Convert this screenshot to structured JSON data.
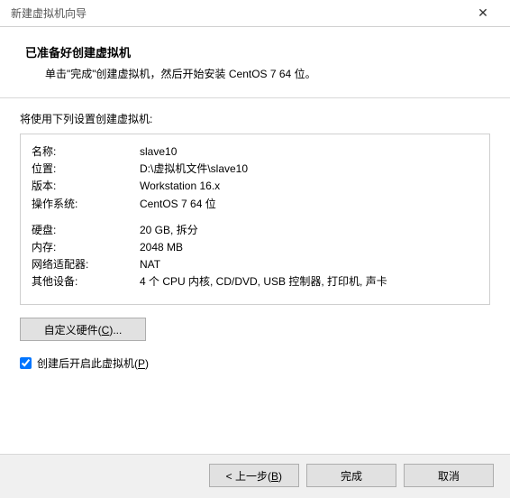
{
  "window": {
    "title": "新建虚拟机向导"
  },
  "header": {
    "title": "已准备好创建虚拟机",
    "subtitle": "单击\"完成\"创建虚拟机，然后开始安装 CentOS 7 64 位。"
  },
  "subheader": "将使用下列设置创建虚拟机:",
  "info": {
    "rows1": [
      {
        "label": "名称:",
        "value": "slave10"
      },
      {
        "label": "位置:",
        "value": "D:\\虚拟机文件\\slave10"
      },
      {
        "label": "版本:",
        "value": "Workstation 16.x"
      },
      {
        "label": "操作系统:",
        "value": "CentOS 7 64 位"
      }
    ],
    "rows2": [
      {
        "label": "硬盘:",
        "value": "20 GB, 拆分"
      },
      {
        "label": "内存:",
        "value": "2048 MB"
      },
      {
        "label": "网络适配器:",
        "value": "NAT"
      },
      {
        "label": "其他设备:",
        "value": "4 个 CPU 内核, CD/DVD, USB 控制器, 打印机, 声卡"
      }
    ]
  },
  "buttons": {
    "customize_pre": "自定义硬件(",
    "customize_u": "C",
    "customize_post": ")...",
    "back_pre": "< 上一步(",
    "back_u": "B",
    "back_post": ")",
    "finish": "完成",
    "cancel": "取消"
  },
  "checkbox": {
    "label_pre": "创建后开启此虚拟机(",
    "label_u": "P",
    "label_post": ")",
    "checked": true
  }
}
